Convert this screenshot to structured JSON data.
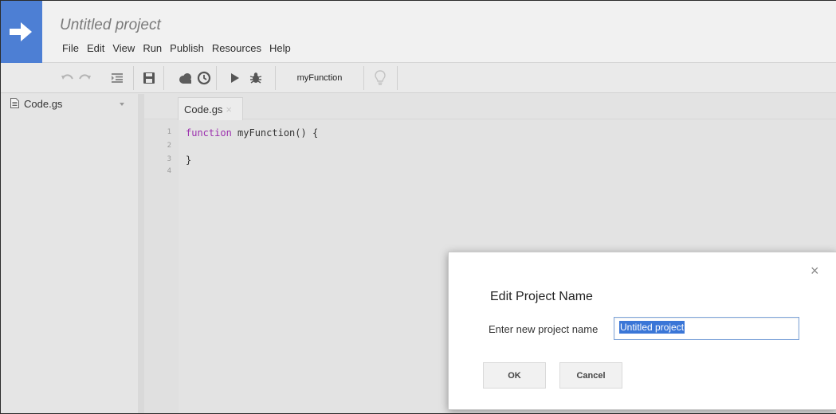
{
  "header": {
    "title": "Untitled project",
    "menu": [
      "File",
      "Edit",
      "View",
      "Run",
      "Publish",
      "Resources",
      "Help"
    ]
  },
  "toolbar": {
    "icons": [
      "undo-icon",
      "redo-icon",
      "indent-icon",
      "save-icon",
      "deploy-cloud-icon",
      "triggers-clock-icon",
      "run-icon",
      "debug-bug-icon",
      "lightbulb-icon"
    ],
    "function_select": "myFunction"
  },
  "files": [
    {
      "name": "Code.gs"
    }
  ],
  "editor": {
    "tab_label": "Code.gs",
    "tab_close": "×",
    "line_numbers": [
      "1",
      "2",
      "3",
      "4"
    ],
    "lines": [
      {
        "keyword": "function",
        "rest": " myFunction() {"
      },
      {
        "keyword": "",
        "rest": ""
      },
      {
        "keyword": "",
        "rest": "}"
      },
      {
        "keyword": "",
        "rest": ""
      }
    ]
  },
  "dialog": {
    "close": "×",
    "title": "Edit Project Name",
    "label": "Enter new project name",
    "input_value": "Untitled project",
    "ok_label": "OK",
    "cancel_label": "Cancel"
  },
  "colors": {
    "logo_blue": "#4d7fd4",
    "keyword_purple": "#9b2fae",
    "selection_blue": "#3a76d7"
  }
}
